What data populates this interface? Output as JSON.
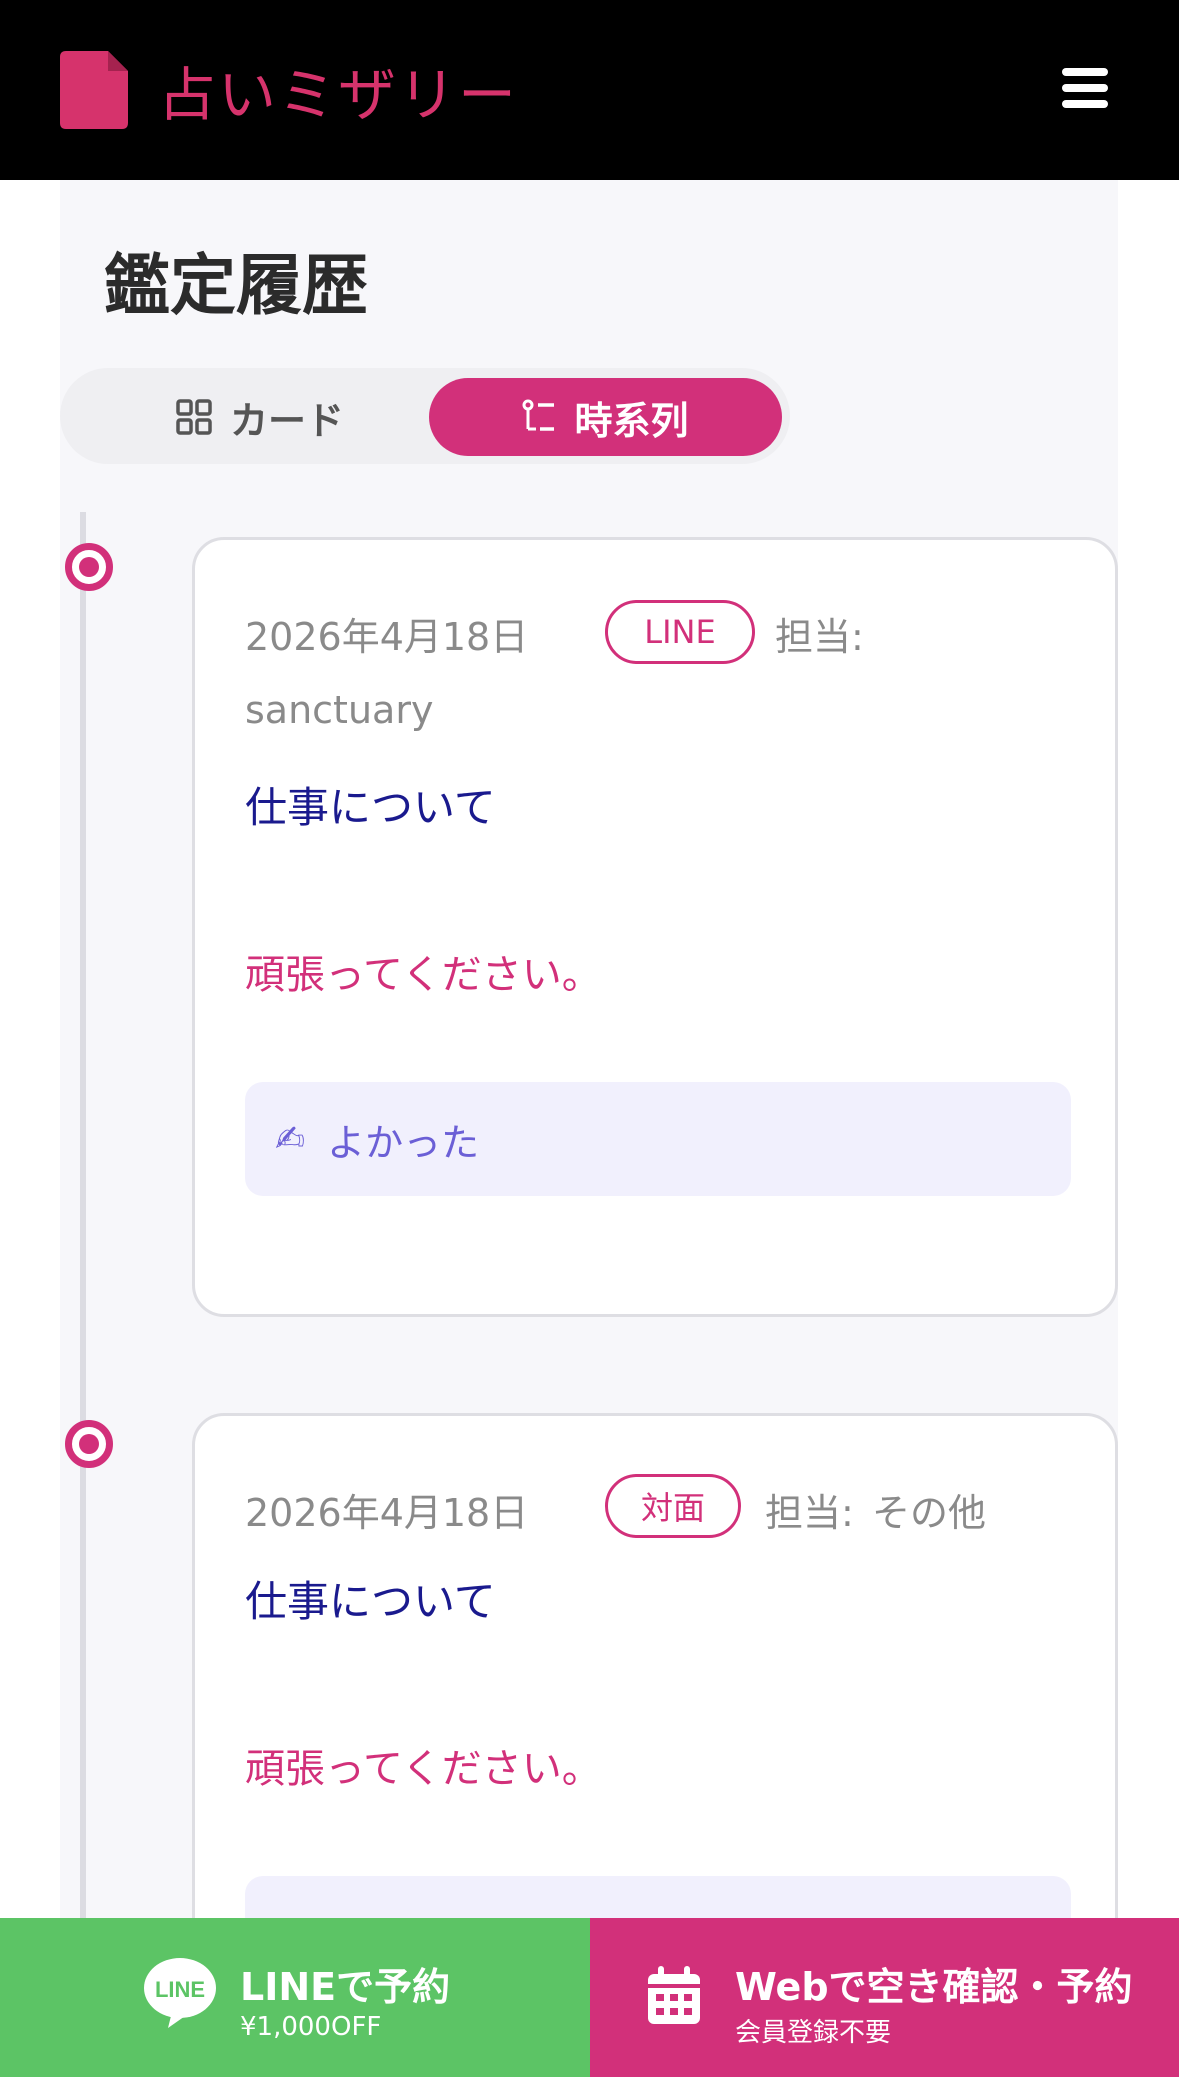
{
  "header": {
    "logo_text": "占いミザリー"
  },
  "page": {
    "title": "鑑定履歴"
  },
  "view_toggle": {
    "card_label": "カード",
    "timeline_label": "時系列",
    "selected": "timeline"
  },
  "entries": [
    {
      "date": "2026年4月18日",
      "channel": "LINE",
      "assignee_label": "担当:",
      "assignee": "sanctuary",
      "topic": "仕事について",
      "message": "頑張ってください。",
      "feedback": "よかった"
    },
    {
      "date": "2026年4月18日",
      "channel": "対面",
      "assignee_label": "担当:",
      "assignee": "その他",
      "topic": "仕事について",
      "message": "頑張ってください。",
      "feedback": ""
    }
  ],
  "bottom_bar": {
    "line_title": "LINEで予約",
    "line_sub": "¥1,000OFF",
    "line_icon_text": "LINE",
    "web_title": "Webで空き確認・予約",
    "web_sub": "会員登録不要"
  },
  "colors": {
    "accent": "#d2307a",
    "line_green": "#5cc465",
    "topic_blue": "#1a1a8e",
    "feedback_bg": "#f1f0fd"
  }
}
